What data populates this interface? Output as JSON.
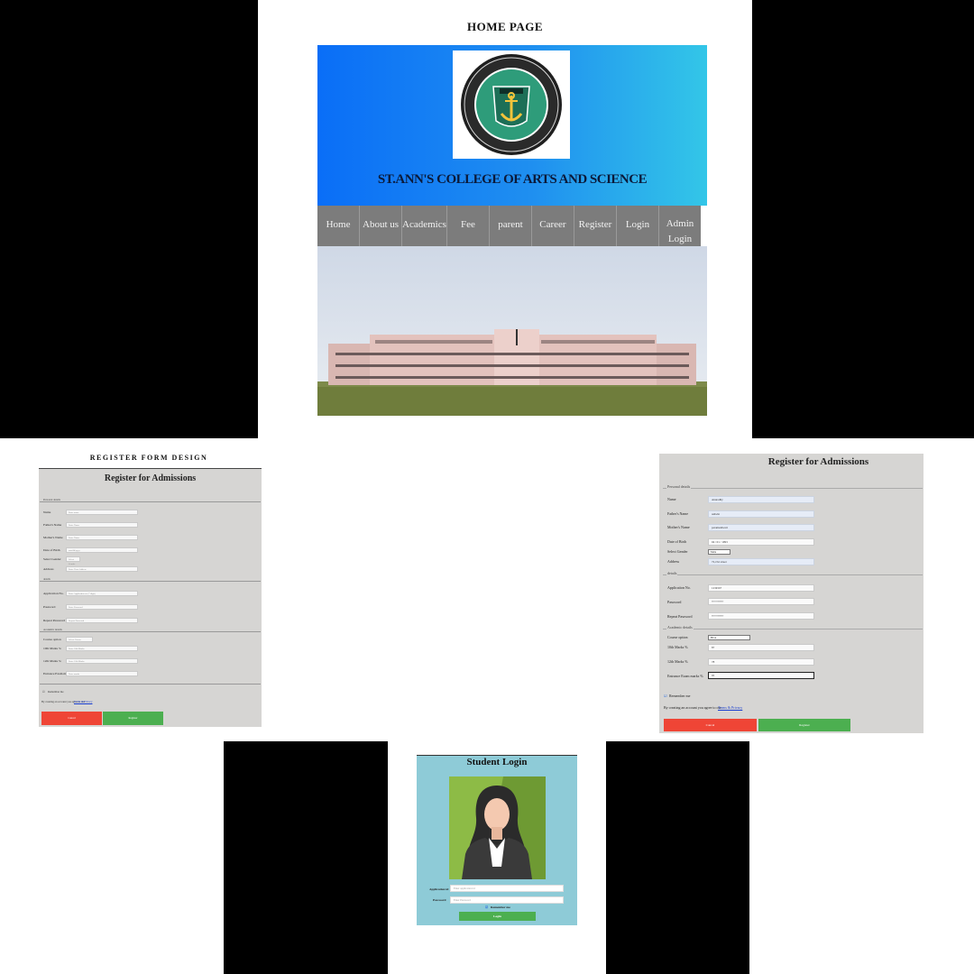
{
  "home": {
    "title": "HOME PAGE",
    "college_name": "ST.ANN'S COLLEGE OF ARTS AND SCIENCE",
    "logo_text": "ST. ANN'S COLLEGE OF ARTS AND SCIENCE",
    "nav": [
      "Home",
      "About us",
      "Academics",
      "Fee",
      "parent",
      "Career",
      "Register",
      "Login",
      "Admin Login"
    ]
  },
  "register_small": {
    "caption": "REGISTER   FORM   DESIGN",
    "title": "Register for Admissions",
    "personal_legend": "Personal details",
    "labels": {
      "name": "Name",
      "father": "Father's Name",
      "mother": "Mother's Name",
      "dob": "Date of Birth",
      "gender": "Select Gender",
      "address": "Address",
      "application": "Application No.",
      "password": "Password",
      "repeat": "Repeat Password",
      "course": "Course option",
      "tenth": "10th Marks %",
      "twelfth": "12th Marks %",
      "entrance": "Entrance Exam marks %"
    },
    "placeholders": {
      "name": "Enter name",
      "father": "Enter Name",
      "mother": "Enter Name",
      "dob": "mm/dd/yyyy",
      "gender": "Select Gender",
      "address": "Enter Your Address",
      "application": "Enter Application no (7 digit)",
      "password": "Enter Password",
      "repeat": "Repeat Password",
      "course": "Select Course",
      "tenth": "Enter 10th Marks",
      "twelfth": "Enter 12th Marks",
      "entrance": "Enter marks"
    },
    "details_legend": "details",
    "academic_legend": "Academic details",
    "remember": "Remember me",
    "terms_text": "By creating an account you agree to our",
    "terms_link": "Terms & Privacy",
    "cancel": "Cancel",
    "register": "Register"
  },
  "register_large": {
    "title": "Register for Admissions",
    "personal_legend": "Personal details",
    "details_legend": "details",
    "academic_legend": "Academic details",
    "labels": {
      "name": "Name",
      "father": "Father's Name",
      "mother": "Mother's Name",
      "dob": "Date of Birth",
      "gender": "Select Gender",
      "address": "Address",
      "application": "Application No.",
      "password": "Password",
      "repeat": "Repeat Password",
      "course": "Course option",
      "tenth": "10th Marks %",
      "twelfth": "12th Marks %",
      "entrance": "Entrance Exam marks %"
    },
    "values": {
      "name": "Anuradhy",
      "father": "ashwin",
      "mother": "parameshwari",
      "dob": "04 / 01 / 1993",
      "gender": "Male",
      "address": "72,vivi street",
      "application": "1234567",
      "password": "••••••••••••",
      "repeat": "••••••••••••",
      "course": "BCA",
      "tenth": "87",
      "twelfth": "78",
      "entrance": "95"
    },
    "remember": "Remember me",
    "terms_text": "By creating an account you agree to our",
    "terms_link": "Terms & Privacy",
    "cancel": "Cancel",
    "register": "Register"
  },
  "login": {
    "title": "Student Login",
    "app_label": "Application id",
    "app_placeholder": "Enter application id",
    "pw_label": "Password",
    "pw_placeholder": "Enter Password",
    "remember": "Remember me",
    "button": "Login"
  },
  "colors": {
    "cancel": "#ef4536",
    "register": "#4caf50",
    "nav_bg": "#7c7c7c",
    "login_bg": "#8ecbd7"
  }
}
